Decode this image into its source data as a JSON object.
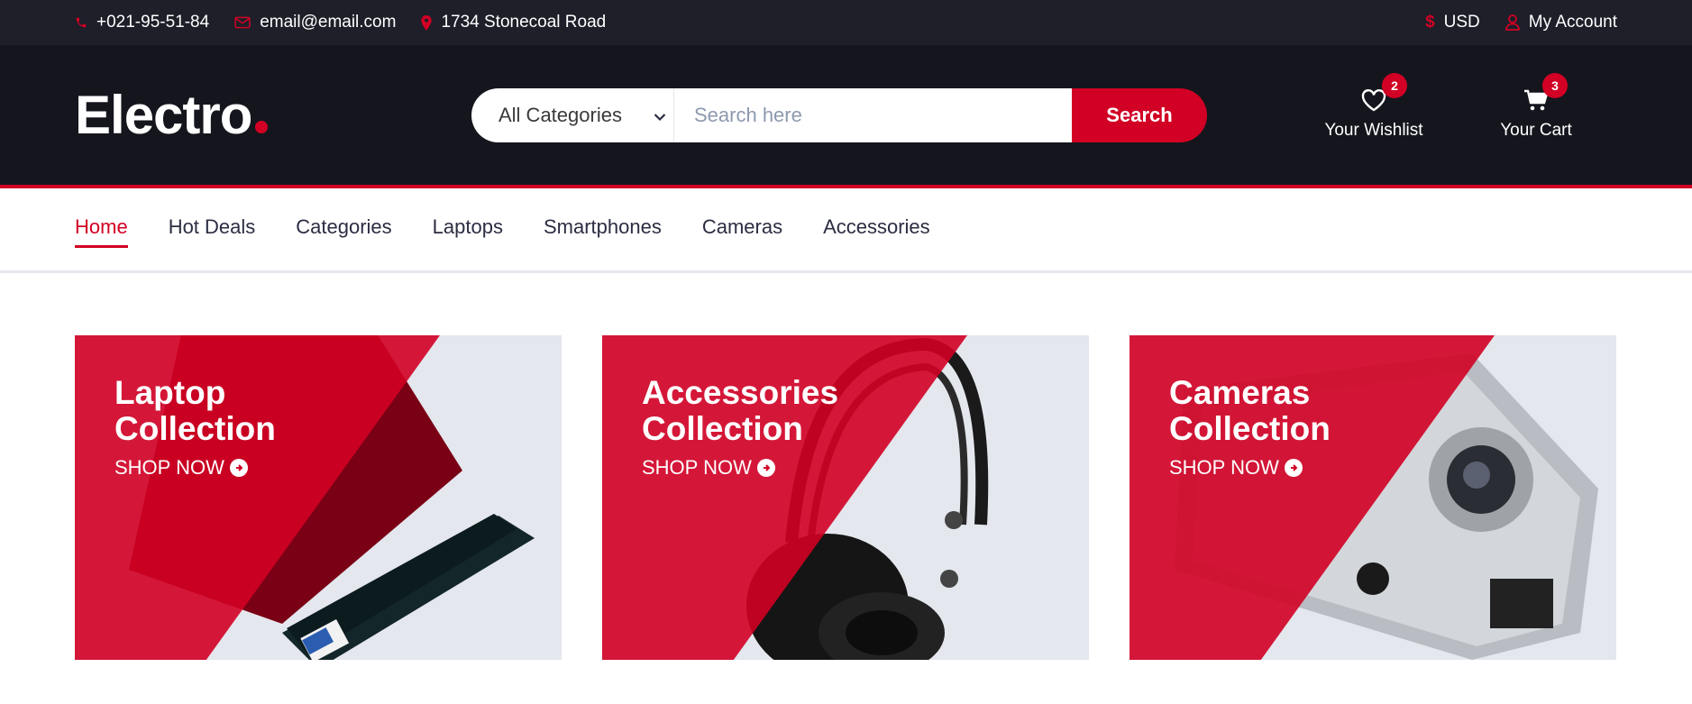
{
  "topbar": {
    "phone": "+021-95-51-84",
    "email": "email@email.com",
    "address": "1734 Stonecoal Road",
    "currency": "USD",
    "account": "My Account"
  },
  "header": {
    "logo_text": "Electro",
    "category_selected": "All Categories",
    "search_placeholder": "Search here",
    "search_button": "Search",
    "wishlist_label": "Your Wishlist",
    "wishlist_count": "2",
    "cart_label": "Your Cart",
    "cart_count": "3"
  },
  "nav": {
    "items": [
      {
        "label": "Home",
        "active": true
      },
      {
        "label": "Hot Deals"
      },
      {
        "label": "Categories"
      },
      {
        "label": "Laptops"
      },
      {
        "label": "Smartphones"
      },
      {
        "label": "Cameras"
      },
      {
        "label": "Accessories"
      }
    ]
  },
  "collections": [
    {
      "line1": "Laptop",
      "line2": "Collection",
      "cta": "SHOP NOW",
      "image": "laptop"
    },
    {
      "line1": "Accessories",
      "line2": "Collection",
      "cta": "SHOP NOW",
      "image": "headphones"
    },
    {
      "line1": "Cameras",
      "line2": "Collection",
      "cta": "SHOP NOW",
      "image": "camera"
    }
  ],
  "colors": {
    "brand_red": "#d10024",
    "dark": "#15161d",
    "topbar": "#1e1f29",
    "card_bg": "#e4e7ed"
  }
}
